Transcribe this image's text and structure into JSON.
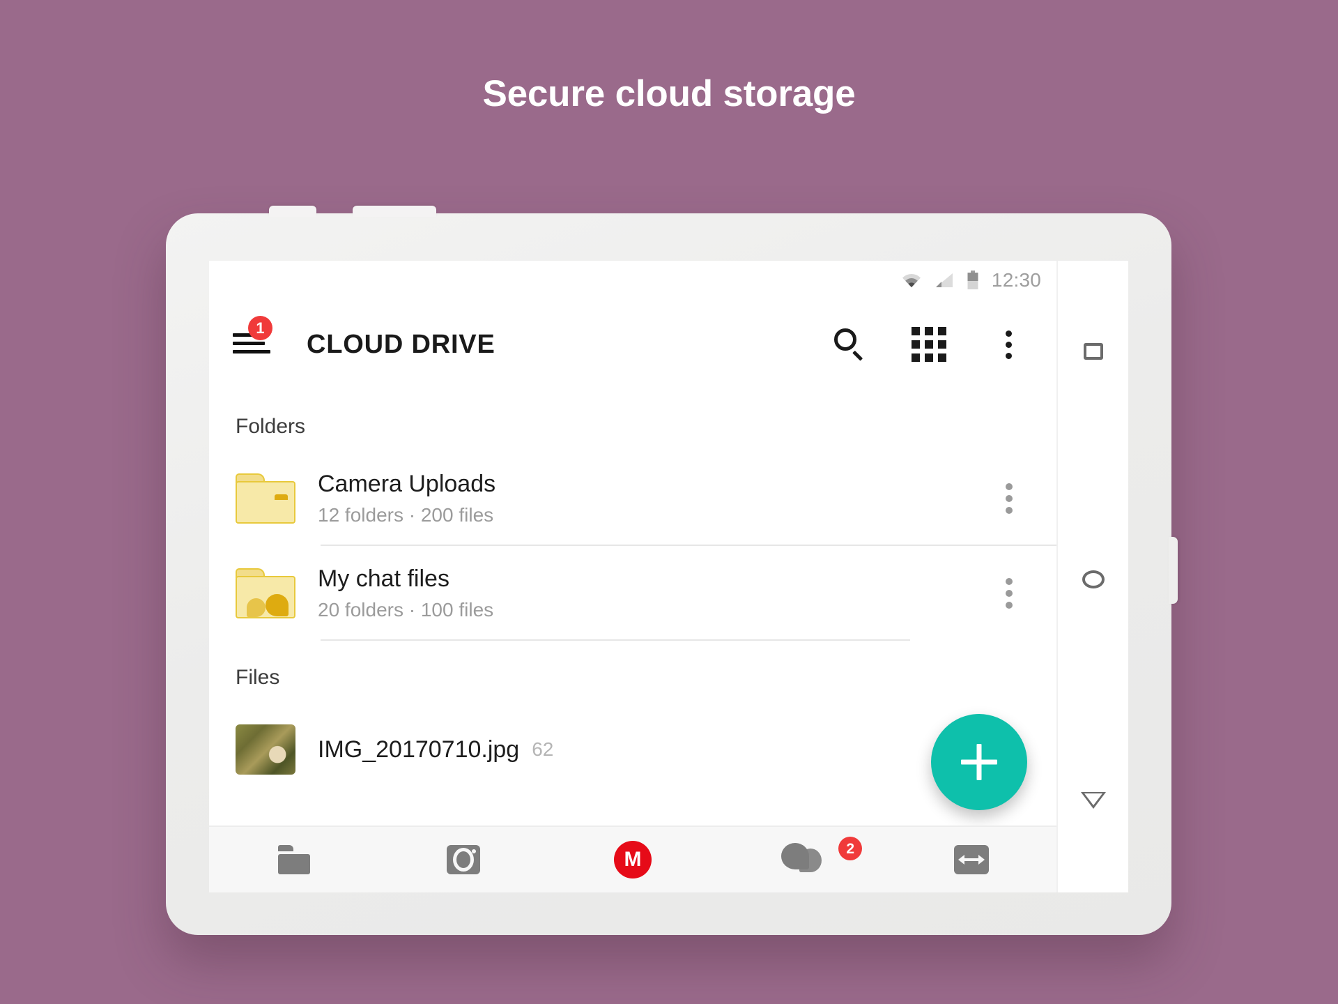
{
  "promo": {
    "headline": "Secure cloud storage"
  },
  "statusbar": {
    "time": "12:30",
    "icons": [
      "wifi-icon",
      "signal-icon",
      "battery-icon"
    ]
  },
  "appbar": {
    "menu_icon": "hamburger-menu-icon",
    "menu_badge": "1",
    "title": "CLOUD DRIVE",
    "actions": [
      {
        "name": "search-icon",
        "label": "Search"
      },
      {
        "name": "grid-view-icon",
        "label": "Grid view"
      },
      {
        "name": "overflow-menu-icon",
        "label": "More options"
      }
    ]
  },
  "content": {
    "folders_header": "Folders",
    "files_header": "Files",
    "folders": [
      {
        "name": "Camera Uploads",
        "meta": "12 folders · 200 files",
        "icon": "camera-folder-icon"
      },
      {
        "name": "My chat files",
        "meta": "20 folders · 100 files",
        "icon": "chat-folder-icon"
      }
    ],
    "files": [
      {
        "name": "IMG_20170710.jpg",
        "meta": "62",
        "icon": "image-thumbnail"
      }
    ]
  },
  "fab": {
    "icon": "plus-icon",
    "label": "Add",
    "color": "#0ec0ab"
  },
  "bottom_nav": [
    {
      "name": "nav-cloud-drive",
      "icon": "folder-icon",
      "badge": ""
    },
    {
      "name": "nav-camera-uploads",
      "icon": "camera-icon",
      "badge": ""
    },
    {
      "name": "nav-mega-home",
      "icon": "mega-logo-icon",
      "badge": "",
      "letter": "M"
    },
    {
      "name": "nav-chat",
      "icon": "chat-bubbles-icon",
      "badge": "2"
    },
    {
      "name": "nav-transfers",
      "icon": "transfers-icon",
      "badge": ""
    }
  ],
  "system_nav": [
    {
      "name": "recents-button",
      "icon": "square-icon"
    },
    {
      "name": "home-button",
      "icon": "circle-icon"
    },
    {
      "name": "back-button",
      "icon": "triangle-down-icon"
    }
  ],
  "colors": {
    "background": "#9a6a8b",
    "accent": "#0ec0ab",
    "badge": "#f03a3a",
    "mega_red": "#e60b18",
    "folder_yellow": "#f7e9a8"
  }
}
